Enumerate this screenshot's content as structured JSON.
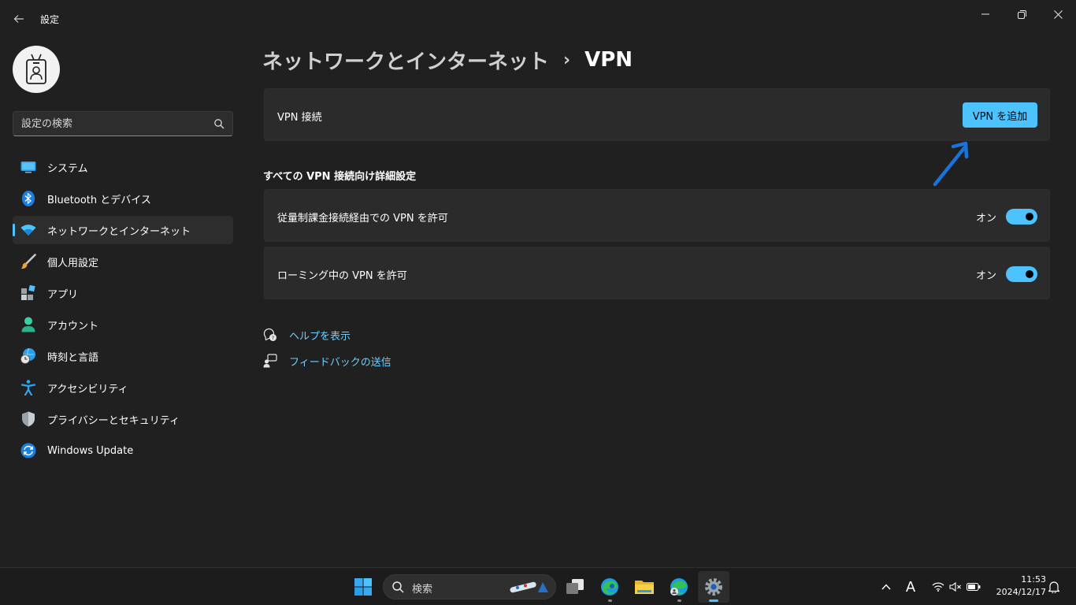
{
  "window": {
    "title": "設定",
    "back_icon": "back-arrow-icon",
    "controls": [
      "minimize-icon",
      "maximize-icon",
      "close-icon"
    ]
  },
  "sidebar": {
    "search": {
      "placeholder": "設定の検索",
      "value": ""
    },
    "items": [
      {
        "label": "システム",
        "icon": "system-monitor-icon",
        "selected": false
      },
      {
        "label": "Bluetooth とデバイス",
        "icon": "bluetooth-icon",
        "selected": false
      },
      {
        "label": "ネットワークとインターネット",
        "icon": "wifi-icon",
        "selected": true
      },
      {
        "label": "個人用設定",
        "icon": "paintbrush-icon",
        "selected": false
      },
      {
        "label": "アプリ",
        "icon": "apps-icon",
        "selected": false
      },
      {
        "label": "アカウント",
        "icon": "account-icon",
        "selected": false
      },
      {
        "label": "時刻と言語",
        "icon": "time-language-icon",
        "selected": false
      },
      {
        "label": "アクセシビリティ",
        "icon": "accessibility-icon",
        "selected": false
      },
      {
        "label": "プライバシーとセキュリティ",
        "icon": "shield-icon",
        "selected": false
      },
      {
        "label": "Windows Update",
        "icon": "windows-update-icon",
        "selected": false
      }
    ]
  },
  "main": {
    "breadcrumb": {
      "parent": "ネットワークとインターネット",
      "separator": "›",
      "current": "VPN"
    },
    "vpn_card": {
      "label": "VPN 接続",
      "button": "VPN を追加"
    },
    "section_title": "すべての VPN 接続向け詳細設定",
    "settings": [
      {
        "label": "従量制課金接続経由での VPN を許可",
        "state": "オン",
        "on": true
      },
      {
        "label": "ローミング中の VPN を許可",
        "state": "オン",
        "on": true
      }
    ],
    "links": [
      {
        "label": "ヘルプを表示",
        "icon": "help-icon"
      },
      {
        "label": "フィードバックの送信",
        "icon": "feedback-icon"
      }
    ],
    "annotation_color": "#1a73d9"
  },
  "taskbar": {
    "search_label": "検索",
    "apps": [
      "start-icon",
      "task-view-icon",
      "edge-icon",
      "file-explorer-icon",
      "edge-profile-icon",
      "settings-icon"
    ],
    "tray": {
      "ime": "A",
      "icons": [
        "chevron-up-icon",
        "wifi-icon",
        "mute-icon",
        "battery-icon",
        "notification-bell-icon"
      ]
    },
    "clock": {
      "time": "11:53",
      "date": "2024/12/17"
    }
  },
  "colors": {
    "accent": "#4cc2ff",
    "background": "#202020",
    "card": "#2b2b2b",
    "link": "#6fcfff"
  }
}
